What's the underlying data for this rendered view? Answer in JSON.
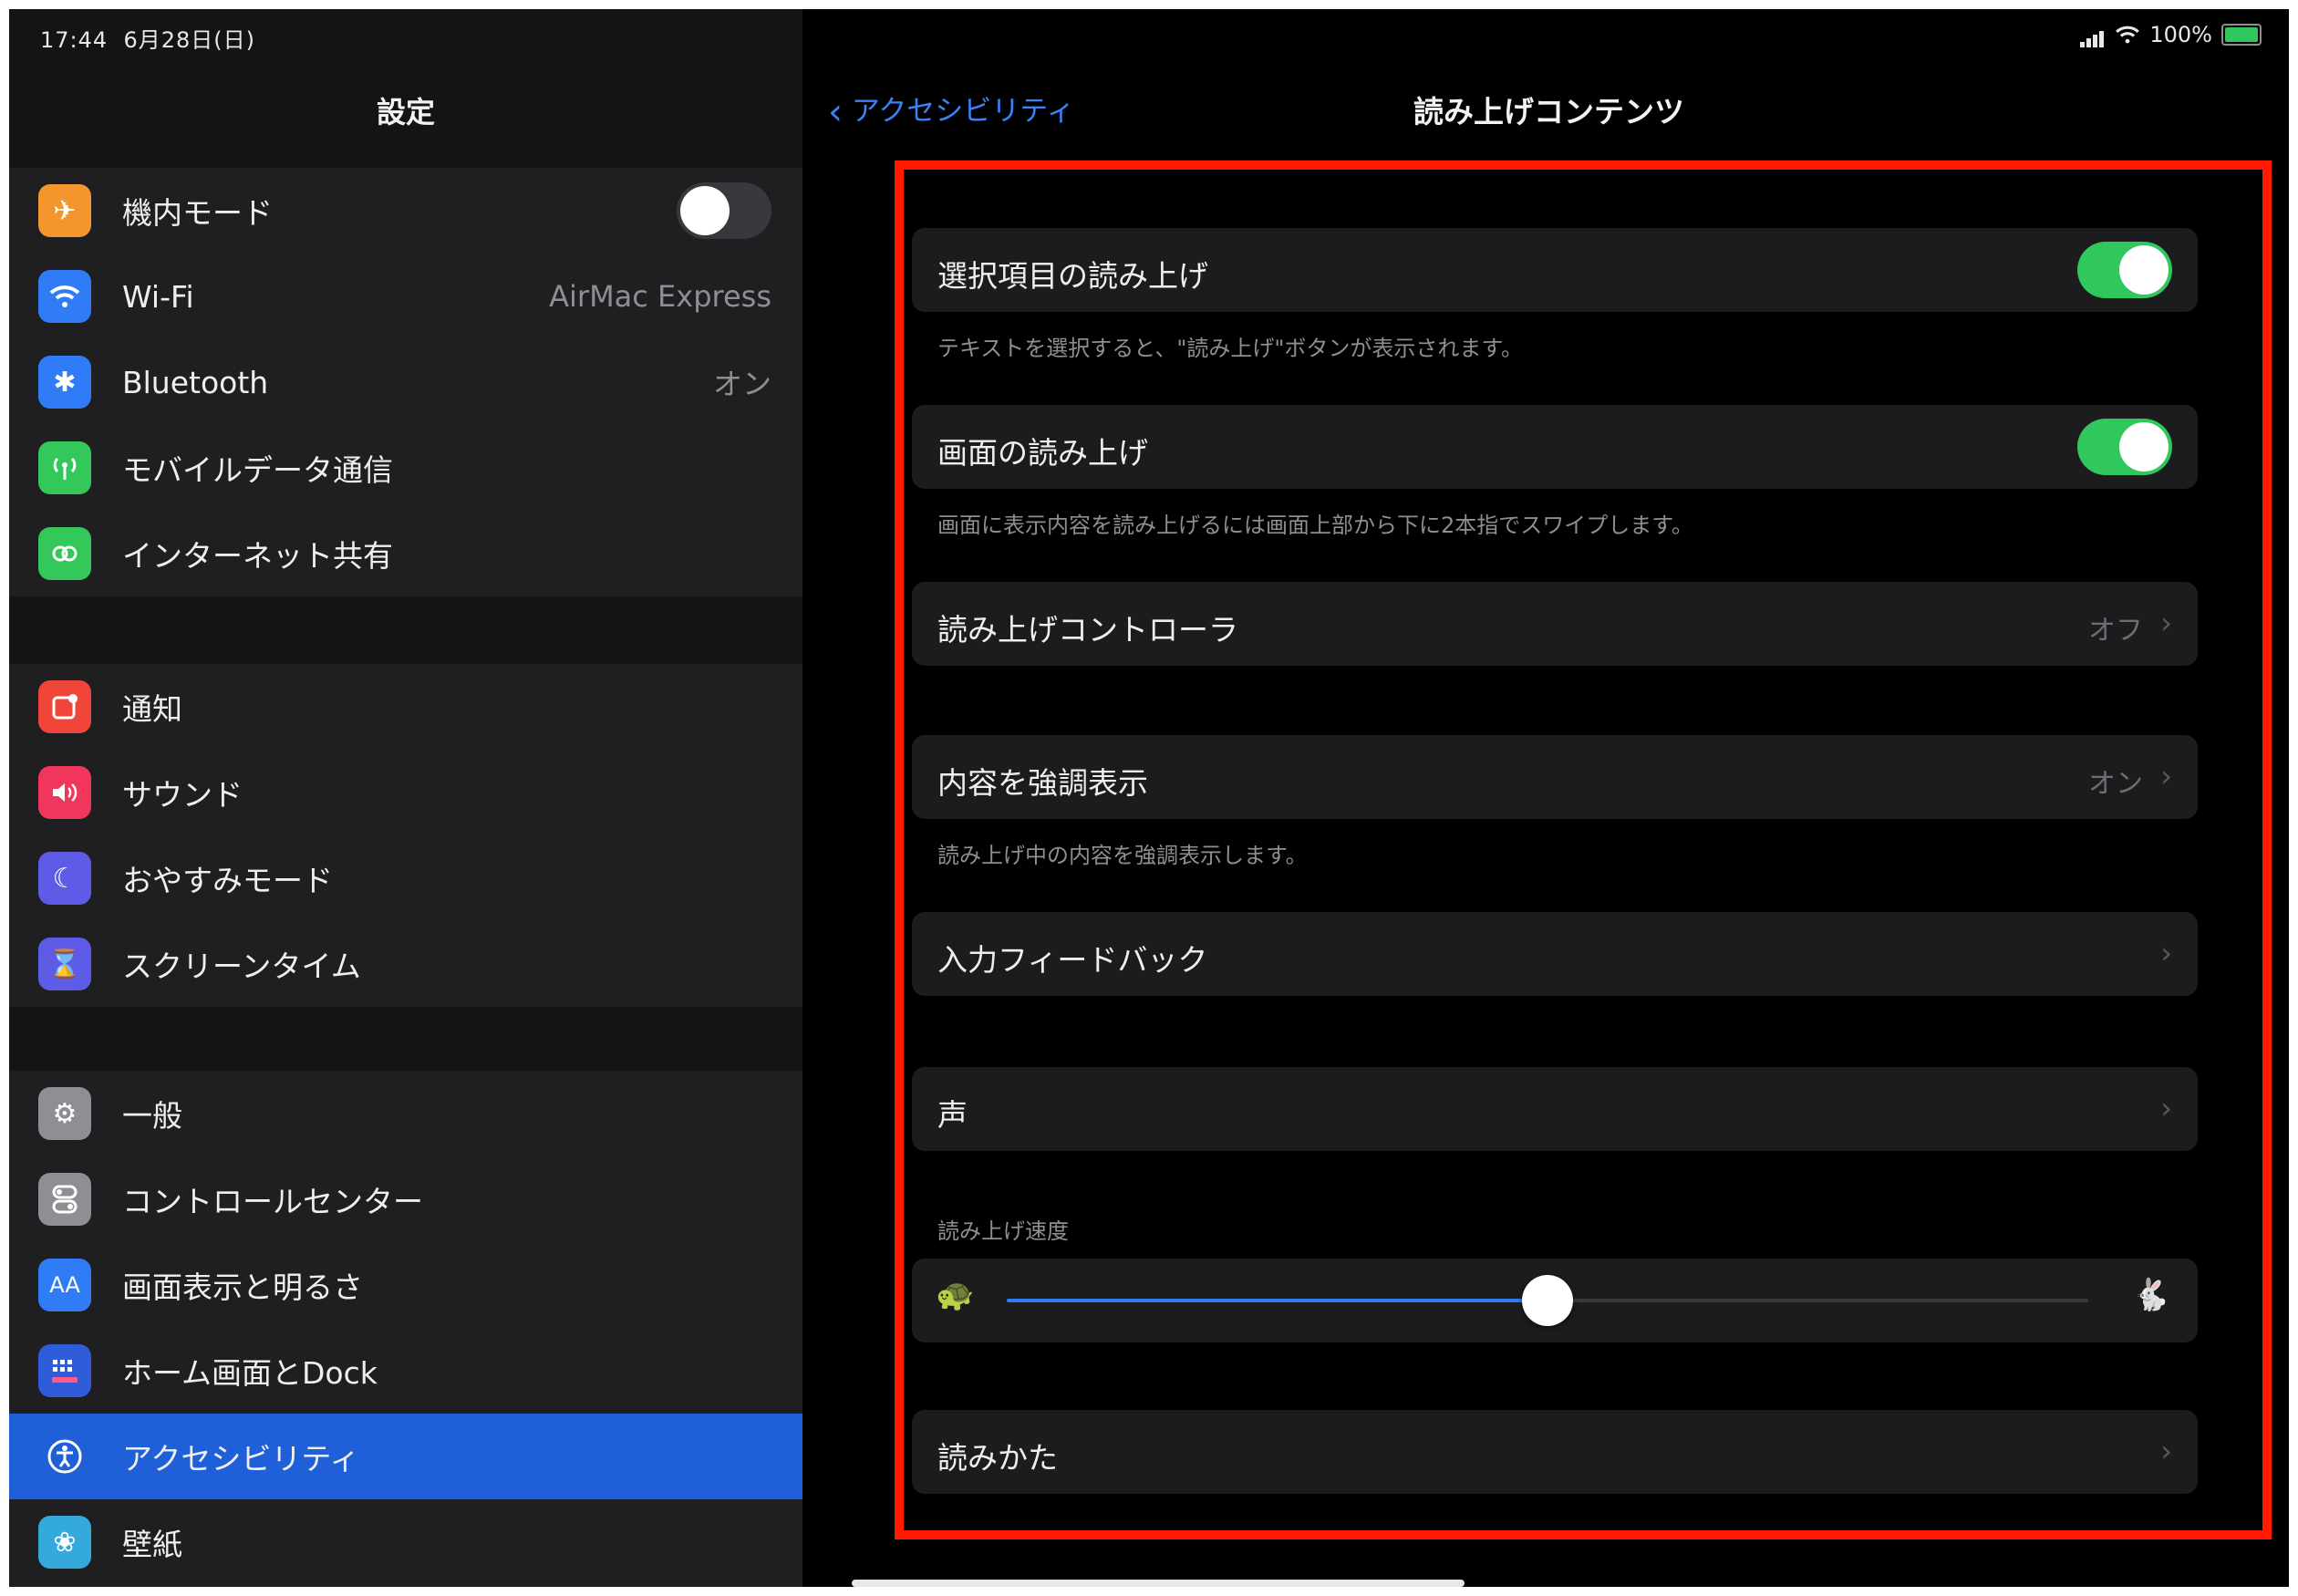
{
  "status_bar": {
    "time": "17:44",
    "date": "6月28日(日)",
    "battery_text": "100%"
  },
  "sidebar": {
    "title": "設定",
    "airplane": {
      "label": "機内モード",
      "on": false
    },
    "wifi": {
      "label": "Wi-Fi",
      "value": "AirMac Express"
    },
    "bluetooth": {
      "label": "Bluetooth",
      "value": "オン"
    },
    "mobile_data": {
      "label": "モバイルデータ通信"
    },
    "hotspot": {
      "label": "インターネット共有"
    },
    "notifications": {
      "label": "通知"
    },
    "sounds": {
      "label": "サウンド"
    },
    "dnd": {
      "label": "おやすみモード"
    },
    "screen_time": {
      "label": "スクリーンタイム"
    },
    "general": {
      "label": "一般"
    },
    "control_center": {
      "label": "コントロールセンター"
    },
    "display": {
      "label": "画面表示と明るさ"
    },
    "home_dock": {
      "label": "ホーム画面とDock"
    },
    "accessibility": {
      "label": "アクセシビリティ"
    },
    "wallpaper": {
      "label": "壁紙"
    }
  },
  "detail": {
    "back_label": "アクセシビリティ",
    "title": "読み上げコンテンツ",
    "speak_selection": {
      "label": "選択項目の読み上げ",
      "on": true,
      "footnote": "テキストを選択すると、\"読み上げ\"ボタンが表示されます。"
    },
    "speak_screen": {
      "label": "画面の読み上げ",
      "on": true,
      "footnote": "画面に表示内容を読み上げるには画面上部から下に2本指でスワイプします。"
    },
    "speech_controller": {
      "label": "読み上げコントローラ",
      "value": "オフ"
    },
    "highlight_content": {
      "label": "内容を強調表示",
      "value": "オン",
      "footnote": "読み上げ中の内容を強調表示します。"
    },
    "typing_feedback": {
      "label": "入力フィードバック"
    },
    "voices": {
      "label": "声"
    },
    "speaking_rate": {
      "header": "読み上げ速度",
      "value": 0.5
    },
    "pronunciations": {
      "label": "読みかた"
    }
  },
  "colors": {
    "accent": "#2f7cf6",
    "toggle_on": "#30c85c",
    "highlight_border": "#ff1a00",
    "selected_row": "#1f5fd8"
  }
}
